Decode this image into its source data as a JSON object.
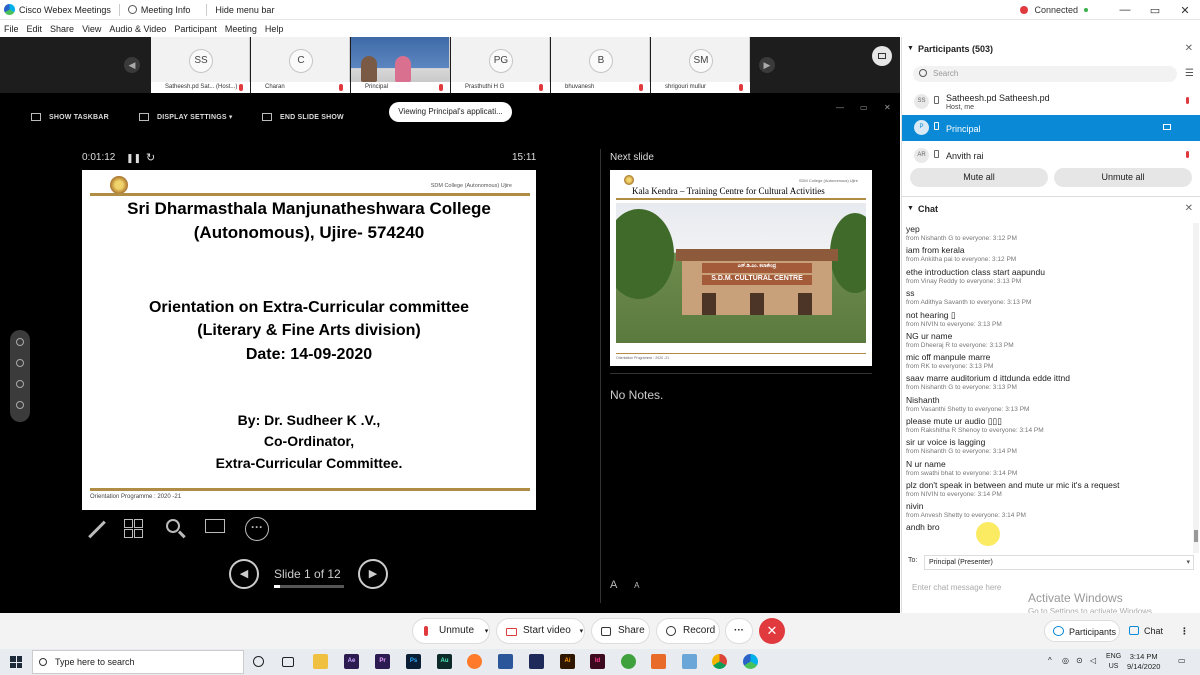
{
  "titlebar": {
    "app_name": "Cisco Webex Meetings",
    "meeting_info": "Meeting Info",
    "hide_menu": "Hide menu bar",
    "status": "Connected",
    "minimize": "—",
    "restore": "▭",
    "close": "✕"
  },
  "menu": [
    "File",
    "Edit",
    "Share",
    "View",
    "Audio & Video",
    "Participant",
    "Meeting",
    "Help"
  ],
  "thumbnails": [
    {
      "initials": "SS",
      "name": "Satheesh.pd Sat... (Host...)"
    },
    {
      "initials": "C",
      "name": "Charan"
    },
    {
      "initials": "",
      "name": "Principal"
    },
    {
      "initials": "PG",
      "name": "Prasthuthi H G"
    },
    {
      "initials": "B",
      "name": "bhuvanesh"
    },
    {
      "initials": "SM",
      "name": "shrigouri mullur"
    }
  ],
  "presenter": {
    "toolbar": {
      "show_taskbar": "SHOW TASKBAR",
      "display_settings": "DISPLAY SETTINGS ▾",
      "end_slide_show": "END SLIDE SHOW"
    },
    "viewing": "Viewing Principal's applicati...",
    "elapsed": "0:01:12",
    "clock": "15:11",
    "next_slide_label": "Next slide",
    "notes": "No Notes.",
    "slide_counter": "Slide 1 of 12",
    "slide_progress": 0.083,
    "font_increase": "A",
    "font_decrease": "A"
  },
  "slide": {
    "header": "SDM College (Autonomous) Ujire",
    "line1": "Sri Dharmasthala Manjunatheshwara College",
    "line2": "(Autonomous), Ujire- 574240",
    "line3": "Orientation on Extra-Curricular committee",
    "line4": "(Literary & Fine Arts division)",
    "line5": "Date: 14-09-2020",
    "line6": "By: Dr. Sudheer  K .V.,",
    "line7": "Co-Ordinator,",
    "line8": "Extra-Curricular Committee.",
    "footer": "Orientation Programme : 2020 -21"
  },
  "next_slide": {
    "header": "SDM College (Autonomous) Ujire",
    "title": "Kala Kendra – Training Centre for Cultural Activities",
    "sign_kannada": "ಎಸ್.ಡಿ.ಎಂ. ಕಲಾಕೇಂದ್ರ",
    "sign": "S.D.M. CULTURAL CENTRE",
    "footer": "Orientation Programme : 2020 -21"
  },
  "participants": {
    "header": "Participants (503)",
    "search_placeholder": "Search",
    "list": [
      {
        "initials": "SS",
        "name": "Satheesh.pd Satheesh.pd",
        "role": "Host, me"
      },
      {
        "initials": "P",
        "name": "Principal",
        "role": ""
      },
      {
        "initials": "AR",
        "name": "Anvith rai",
        "role": ""
      }
    ],
    "mute_all": "Mute all",
    "unmute_all": "Unmute all"
  },
  "chat": {
    "header": "Chat",
    "messages": [
      {
        "text": "yep",
        "meta": "from Nishanth G to everyone:   3:12 PM"
      },
      {
        "text": "iam from kerala",
        "meta": "from Ankitha pai to everyone:   3:12 PM"
      },
      {
        "text": "ethe introduction class start aapundu",
        "meta": "from Vinay Reddy to everyone:   3:13 PM"
      },
      {
        "text": "ss",
        "meta": "from Adithya Savanth to everyone:   3:13 PM"
      },
      {
        "text": "not hearing ▯",
        "meta": "from NIVIN to everyone:   3:13 PM"
      },
      {
        "text": "NG  ur name",
        "meta": "from Dheeraj R to everyone:   3:13 PM"
      },
      {
        "text": "mic off manpule marre",
        "meta": "from RK to everyone:   3:13 PM"
      },
      {
        "text": "saav marre auditorium d ittdunda edde ittnd",
        "meta": "from Nishanth G to everyone:   3:13 PM"
      },
      {
        "text": "Nishanth",
        "meta": "from Vasanthi Shetty to everyone:   3:13 PM"
      },
      {
        "text": "please mute ur audio ▯▯▯",
        "meta": "from Rakshitha R Shenoy to everyone:   3:14 PM"
      },
      {
        "text": "sir ur voice is lagging",
        "meta": "from Nishanth G to everyone:   3:14 PM"
      },
      {
        "text": "N ur name",
        "meta": "from swathi bhat to everyone:   3:14 PM"
      },
      {
        "text": "plz don't speak in between and mute ur mic it's a request",
        "meta": "from NIVIN to everyone:   3:14 PM"
      },
      {
        "text": "nivin",
        "meta": "from Anvesh Shetty to everyone:   3:14 PM"
      },
      {
        "text": "andh bro",
        "meta": ""
      }
    ],
    "to_label": "To:",
    "to_value": "Principal (Presenter)",
    "input_placeholder": "Enter chat message here",
    "activate_title": "Activate Windows",
    "activate_sub": "Go to Settings to activate Windows."
  },
  "controls": {
    "unmute": "Unmute",
    "start_video": "Start video",
    "share": "Share",
    "record": "Record",
    "more": "···",
    "end": "✕",
    "participants_tab": "Participants",
    "chat_tab": "Chat",
    "more_tab": "⋮"
  },
  "taskbar": {
    "search_placeholder": "Type here to search",
    "lang": "ENG",
    "region": "US",
    "time": "3:14 PM",
    "date": "9/14/2020",
    "apps": [
      "Ae",
      "Pr",
      "Ps",
      "Au",
      "Ai",
      "Id"
    ]
  },
  "colors": {
    "accent": "#0a8ad6",
    "end_red": "#e0393e",
    "slide_rule": "#b08d45"
  }
}
